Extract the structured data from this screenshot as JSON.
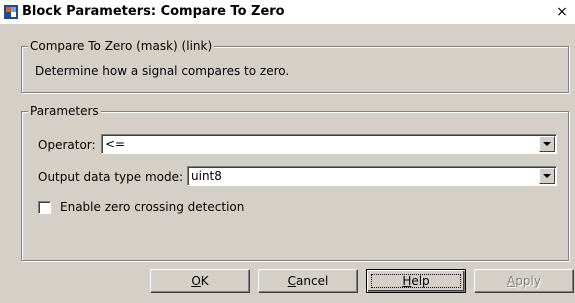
{
  "window": {
    "title": "Block Parameters: Compare To Zero",
    "close_glyph": "×"
  },
  "description_group": {
    "legend": "Compare To Zero (mask) (link)",
    "text": "Determine how a signal compares to zero."
  },
  "parameters_group": {
    "legend": "Parameters",
    "operator_label": "Operator:",
    "operator_value": "<=",
    "output_mode_label": "Output data type mode:",
    "output_mode_value": "uint8",
    "zero_crossing_label": "Enable zero crossing detection",
    "zero_crossing_checked": false
  },
  "buttons": {
    "ok": {
      "accel": "O",
      "rest": "K"
    },
    "cancel": {
      "accel": "C",
      "rest": "ancel"
    },
    "help": {
      "accel": "H",
      "rest": "elp"
    },
    "apply": {
      "accel": "A",
      "rest": "pply"
    }
  },
  "icons": {
    "app": "simulink-block-icon",
    "dropdown": "chevron-down-icon",
    "close": "close-icon"
  }
}
